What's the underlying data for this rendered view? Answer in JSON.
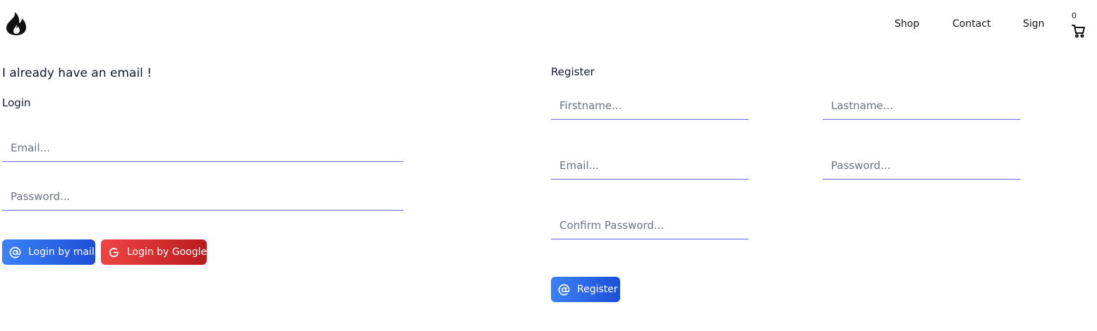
{
  "header": {
    "logo_icon": "flame-icon",
    "nav": {
      "shop": "Shop",
      "contact": "Contact",
      "sign": "Sign"
    },
    "cart": {
      "count": "0",
      "icon": "cart-icon"
    }
  },
  "login": {
    "intro": "I already have an email !",
    "heading": "Login",
    "email_placeholder": "Email...",
    "password_placeholder": "Password...",
    "mail_button_label": "Login by mail",
    "mail_button_icon": "at-sign-icon",
    "google_button_label": "Login by Google",
    "google_button_icon": "google-icon"
  },
  "register": {
    "heading": "Register",
    "firstname_placeholder": "Firstname...",
    "lastname_placeholder": "Lastname...",
    "email_placeholder": "Email...",
    "password_placeholder": "Password...",
    "confirm_placeholder": "Confirm Password...",
    "button_label": "Register",
    "button_icon": "at-sign-icon"
  },
  "colors": {
    "field_underline": "#6366f1",
    "primary_button": "#2563eb",
    "google_button": "#dc2626"
  }
}
